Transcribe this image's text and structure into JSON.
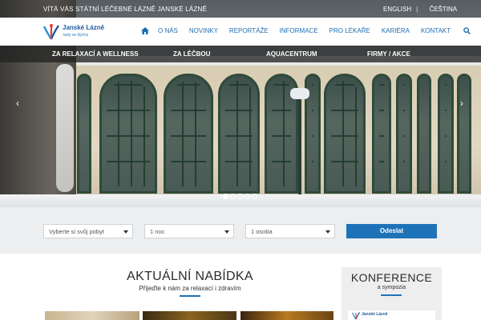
{
  "topbar": {
    "welcome": "VÍTÁ VÁS STÁTNÍ LÉČEBNÉ LÁZNĚ JANSKÉ LÁZNĚ",
    "lang_en": "ENGLISH",
    "lang_sep": "|",
    "lang_cs": "ČEŠTINA"
  },
  "logo": {
    "name": "Janské Lázně",
    "tagline": "tady se dýchá"
  },
  "menu": {
    "items": [
      "O NÁS",
      "NOVINKY",
      "REPORTÁŽE",
      "INFORMACE",
      "PRO LÉKAŘE",
      "KARIÉRA",
      "KONTAKT"
    ]
  },
  "categories": [
    "ZA RELAXACÍ A WELLNESS",
    "ZA LÉČBOU",
    "AQUACENTRUM",
    "FIRMY / AKCE"
  ],
  "slider": {
    "prev": "‹",
    "next": "›",
    "dots_total": 5,
    "active_index": 0
  },
  "booking": {
    "stay": "Vyberte si svůj pobyt",
    "nights": "1 noc",
    "persons": "1 osoba",
    "submit": "Odeslat"
  },
  "offer": {
    "title": "AKTUÁLNÍ NABÍDKA",
    "subtitle": "Přijeďte k nám za relaxací i zdravím"
  },
  "sidebox": {
    "title": "KONFERENCE",
    "subtitle": "a sympozia",
    "logo_text": "Janské Lázně"
  },
  "colors": {
    "accent": "#1e73b8",
    "brand_text": "#1e5a9c",
    "dark_strip": "#232323"
  }
}
